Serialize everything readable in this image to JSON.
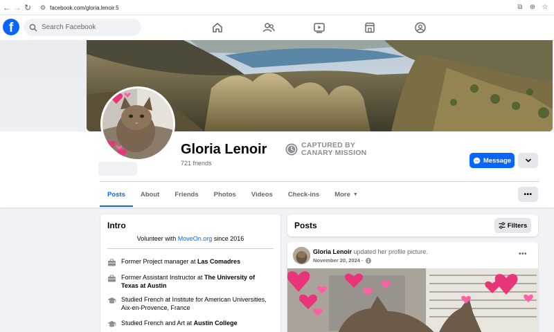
{
  "browser": {
    "url": "facebook.com/gloria.lenoir.5"
  },
  "header": {
    "logo": "f",
    "search_placeholder": "Search Facebook",
    "nav_icons": [
      "home-icon",
      "friends-icon",
      "video-icon",
      "marketplace-icon",
      "groups-icon"
    ]
  },
  "profile": {
    "name": "Gloria Lenoir",
    "friends": "721 friends",
    "badge_line1": "CAPTURED BY",
    "badge_line2": "CANARY MISSION",
    "message_label": "Message"
  },
  "tabs": [
    {
      "label": "Posts",
      "active": true
    },
    {
      "label": "About"
    },
    {
      "label": "Friends"
    },
    {
      "label": "Photos"
    },
    {
      "label": "Videos"
    },
    {
      "label": "Check-ins"
    },
    {
      "label": "More"
    }
  ],
  "intro": {
    "title": "Intro",
    "bio_prefix": "Volunteer with ",
    "bio_link": "MoveOn.org",
    "bio_suffix": " since 2016",
    "items": [
      {
        "icon": "briefcase-icon",
        "text": "Former Project manager at ",
        "bold": "Las Comadres"
      },
      {
        "icon": "briefcase-icon",
        "text": "Former Assistant Instructor at ",
        "bold": "The University of Texas at Austin"
      },
      {
        "icon": "graduation-cap-icon",
        "text": "Studied French at Institute for American Universities, Aix-en-Provence, France",
        "bold": ""
      },
      {
        "icon": "graduation-cap-icon",
        "text": "Studied French and Art at ",
        "bold": "Austin College"
      }
    ]
  },
  "posts": {
    "title": "Posts",
    "filters_label": "Filters",
    "post": {
      "author": "Gloria Lenoir",
      "action": " updated her profile picture.",
      "date": "November 20, 2024 ·"
    }
  },
  "colors": {
    "brand": "#0866ff",
    "background": "#f0f2f5",
    "secondary_text": "#65676b"
  }
}
